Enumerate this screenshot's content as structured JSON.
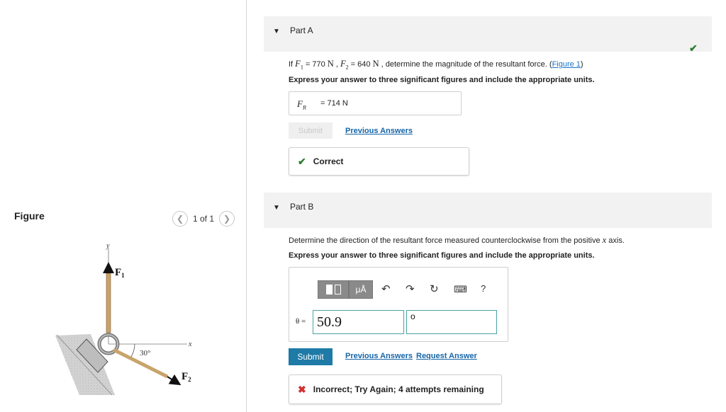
{
  "figure": {
    "title": "Figure",
    "pager_text": "1 of 1",
    "labels": {
      "y_axis": "y",
      "x_axis": "x",
      "f1": "F",
      "f1_sub": "1",
      "f2": "F",
      "f2_sub": "2",
      "angle": "30°"
    }
  },
  "part_a": {
    "title": "Part A",
    "question_prefix": "If ",
    "question_f1": "F",
    "question_f1_sub": "1",
    "question_eq1": " = 770 ",
    "question_unit1": "N",
    "question_sep": " , ",
    "question_f2": "F",
    "question_f2_sub": "2",
    "question_eq2": " = 640 ",
    "question_unit2": "N",
    "question_suffix": " , determine the magnitude of the resultant force. (",
    "figure_link": "Figure 1",
    "question_close": ")",
    "instruction": "Express your answer to three significant figures and include the appropriate units.",
    "answer_label": "F",
    "answer_label_sub": "R",
    "answer_eq": " = ",
    "answer_value": "714 N",
    "submit_label": "Submit",
    "previous_answers": "Previous Answers",
    "feedback": "Correct"
  },
  "part_b": {
    "title": "Part B",
    "question_main": "Determine the direction of the resultant force measured counterclockwise from the positive ",
    "question_var": "x",
    "question_end": " axis.",
    "instruction": "Express your answer to three significant figures and include the appropriate units.",
    "toolbar": {
      "mu_label": "μÅ",
      "help_label": "?"
    },
    "theta_label": "θ =",
    "value": "50.9",
    "unit": "o",
    "submit_label": "Submit",
    "previous_answers": "Previous Answers",
    "request_answer": "Request Answer",
    "feedback": "Incorrect; Try Again; 4 attempts remaining"
  },
  "colors": {
    "correct": "#2e7d32",
    "incorrect": "#d32f2f",
    "submit": "#1e7aa6",
    "link": "#1565a8"
  }
}
